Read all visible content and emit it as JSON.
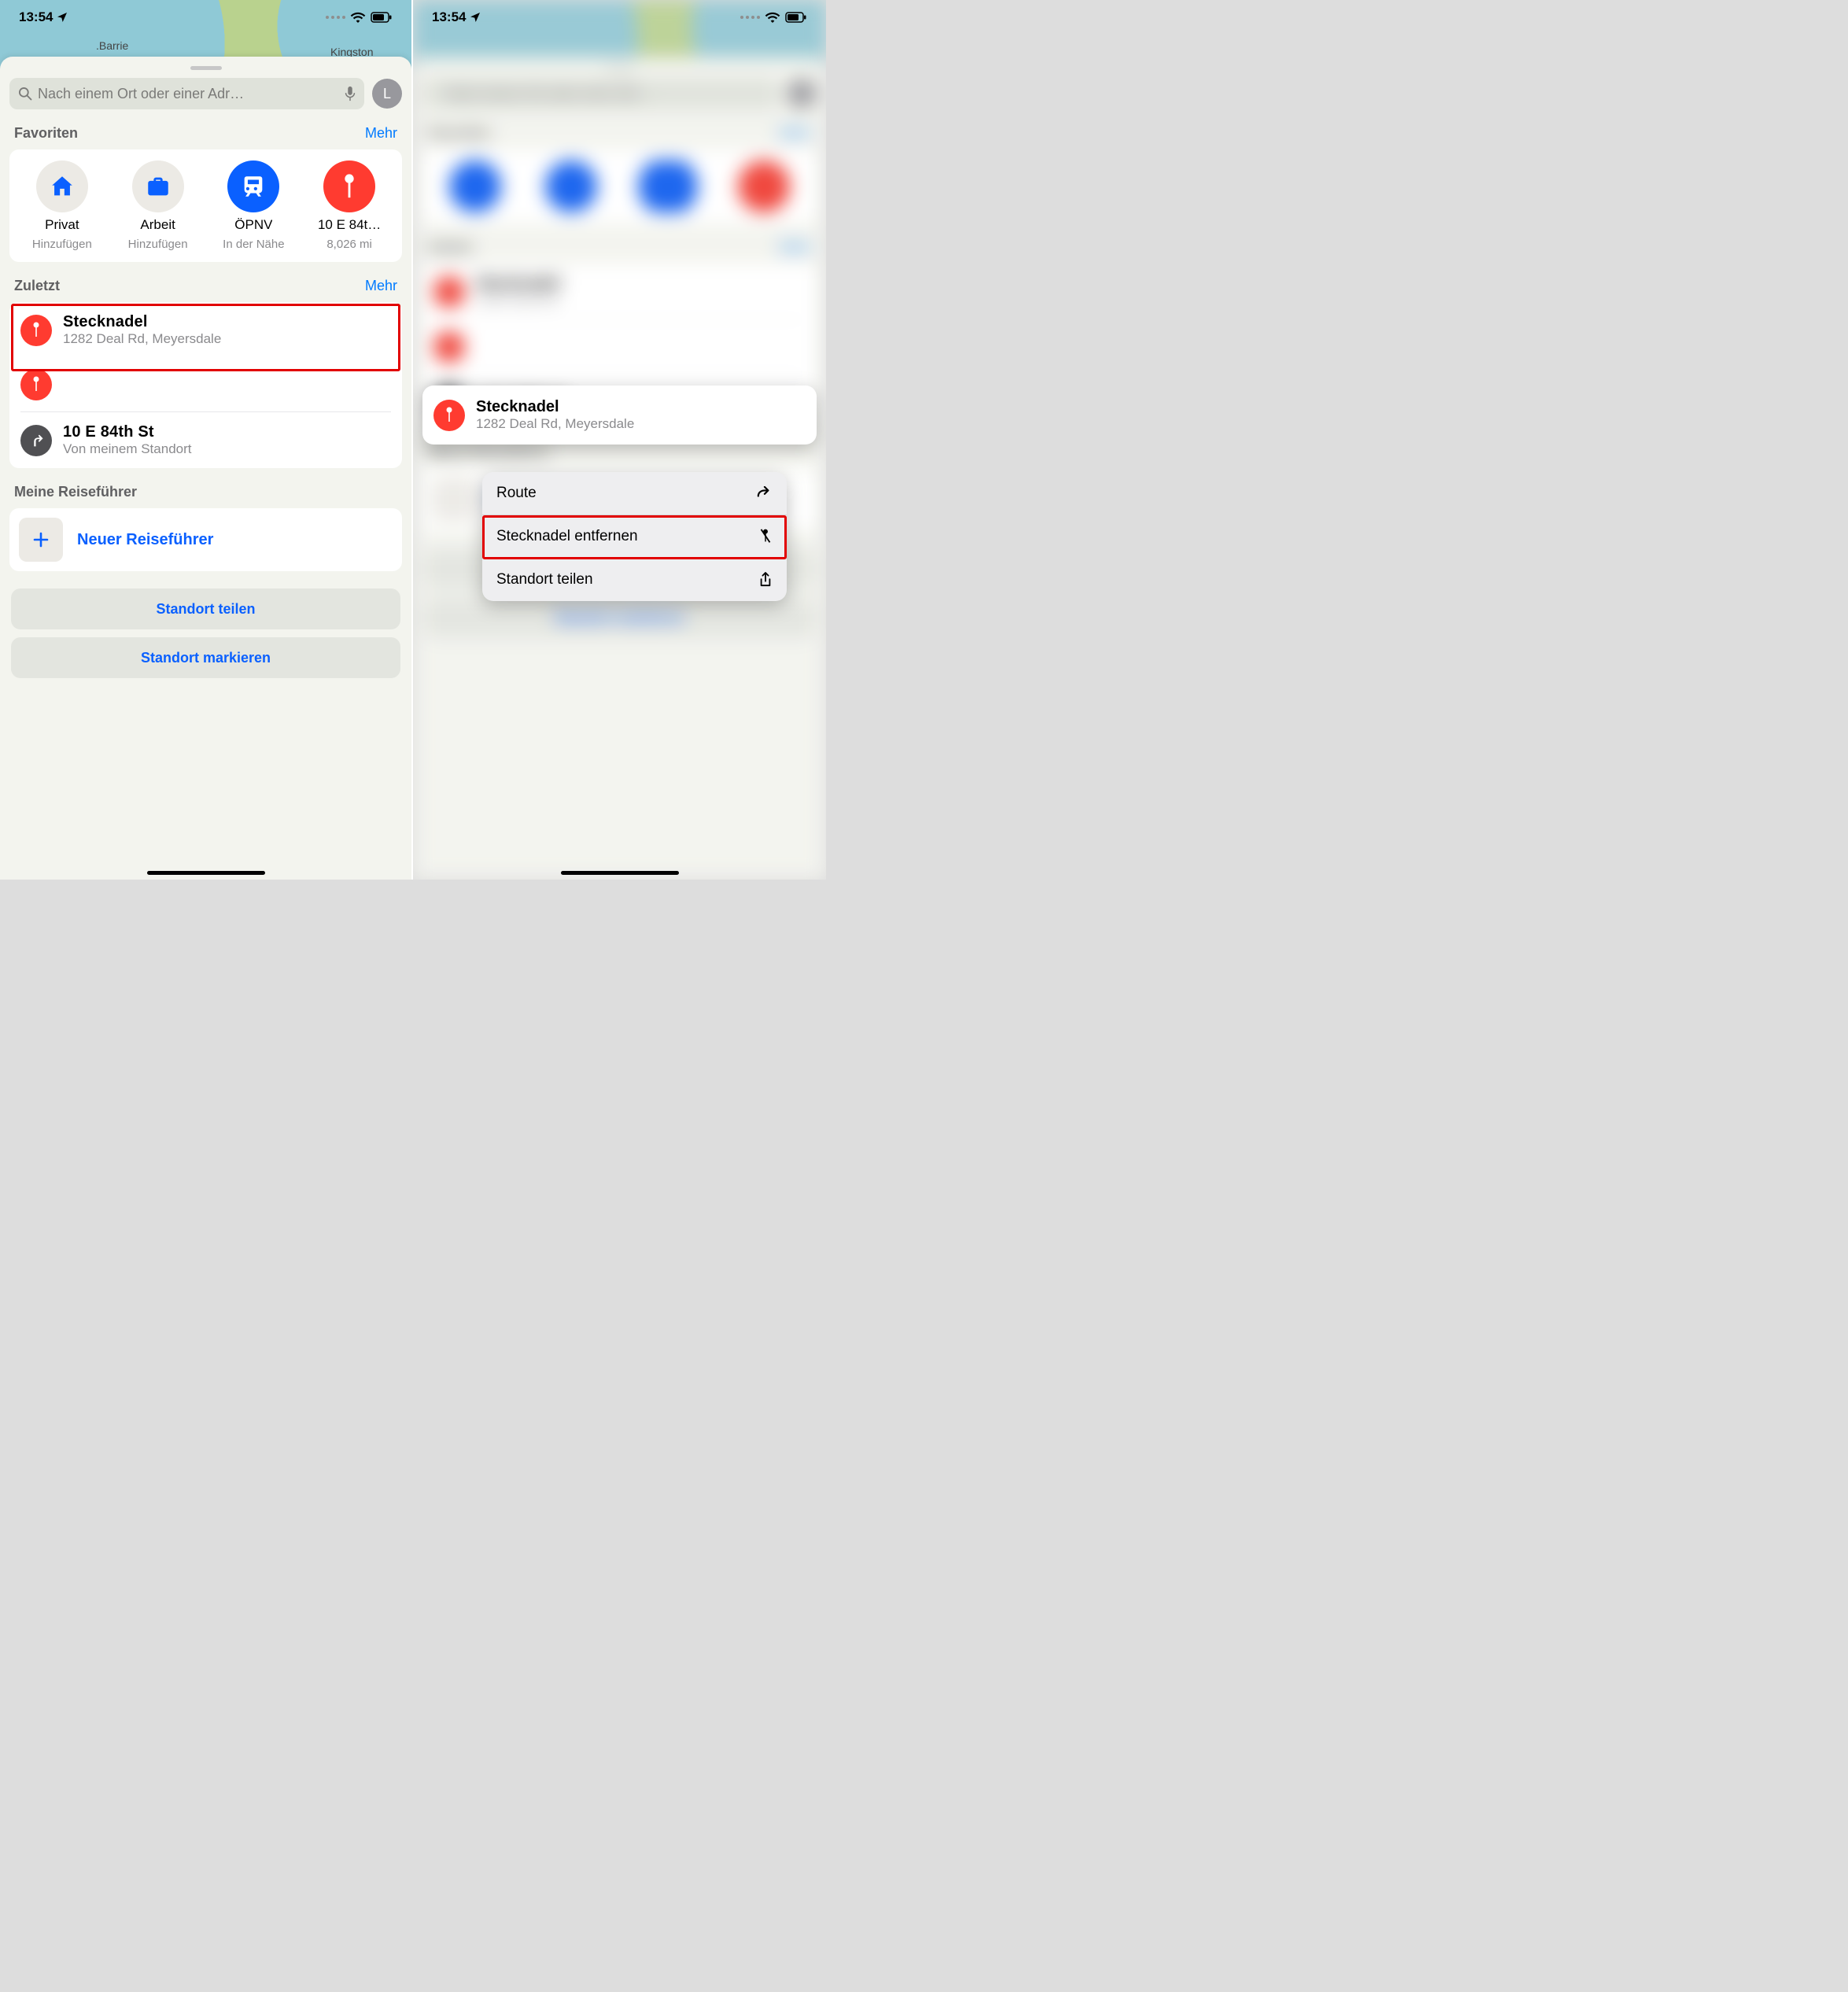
{
  "status": {
    "time": "13:54"
  },
  "map": {
    "city1": ".Barrie",
    "city2": "Kingston"
  },
  "search": {
    "placeholder": "Nach einem Ort oder einer Adr…",
    "avatar": "L"
  },
  "sections": {
    "favorites": {
      "title": "Favoriten",
      "more": "Mehr"
    },
    "recent": {
      "title": "Zuletzt",
      "more": "Mehr"
    },
    "guides": {
      "title": "Meine Reiseführer"
    }
  },
  "favorites": [
    {
      "label": "Privat",
      "sub": "Hinzufügen"
    },
    {
      "label": "Arbeit",
      "sub": "Hinzufügen"
    },
    {
      "label": "ÖPNV",
      "sub": "In der Nähe"
    },
    {
      "label": "10 E 84t…",
      "sub": "8,026 mi"
    }
  ],
  "recent": [
    {
      "title": "Stecknadel",
      "sub": "1282 Deal Rd, Meyersdale"
    },
    {
      "title": "",
      "sub": ""
    },
    {
      "title": "10 E 84th St",
      "sub": "Von meinem Standort"
    }
  ],
  "guide": {
    "new": "Neuer Reiseführer"
  },
  "actions": {
    "share": "Standort teilen",
    "mark": "Standort markieren"
  },
  "popup": {
    "title": "Stecknadel",
    "sub": "1282 Deal Rd, Meyersdale"
  },
  "context": {
    "route": "Route",
    "remove": "Stecknadel entfernen",
    "share": "Standort teilen"
  }
}
